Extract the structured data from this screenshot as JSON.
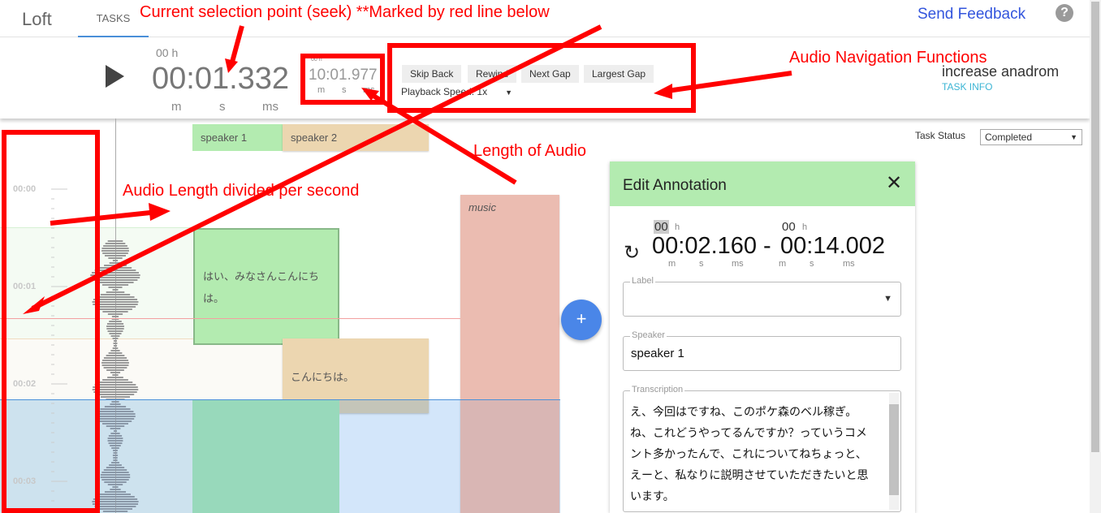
{
  "header": {
    "logo": "Loft",
    "tab": "TASKS",
    "feedback": "Send Feedback",
    "help": "?"
  },
  "toolbar": {
    "hours": "00 h",
    "time": "00:01.332",
    "units": [
      "m",
      "s",
      "ms"
    ],
    "duration": {
      "hours": "00 h",
      "time": "10:01.977",
      "units": [
        "m",
        "s",
        "ms"
      ]
    },
    "buttons": [
      "Skip Back",
      "Rewind",
      "Next Gap",
      "Largest Gap"
    ],
    "playback_speed_label": "Playback Speed: 1x",
    "task_name": "increase anadrom",
    "task_info": "TASK INFO"
  },
  "task_status": {
    "label": "Task Status",
    "value": "Completed"
  },
  "speakers": [
    "speaker 1",
    "speaker 2"
  ],
  "timeline": {
    "ticks": [
      "00:00",
      "00:01",
      "00:02",
      "00:03"
    ]
  },
  "segments": {
    "s1": "はい、みなさんこんにちは。",
    "s2": "こんにちは。",
    "music": "music"
  },
  "add_button": "+",
  "panel": {
    "title": "Edit Annotation",
    "start_h": "00",
    "end_h": "00",
    "h": "h",
    "start": "00:02.160",
    "sep": "-",
    "end": "00:14.002",
    "units": [
      "m",
      "s",
      "ms"
    ],
    "label_field": "Label",
    "label_value": "",
    "speaker_field": "Speaker",
    "speaker_value": "speaker 1",
    "transcription_field": "Transcription",
    "transcription": "え、今回はですね、このポケ森のベル稼ぎ。ね、これどうやってるんですか？っていうコメント多かったんで、これについてねちょっと、えーと、私なりに説明させていただきたいと思います。"
  },
  "annotations": {
    "seek": "Current selection point (seek) **Marked by red line below",
    "nav": "Audio Navigation Functions",
    "length": "Length of Audio",
    "per_second": "Audio Length divided per second"
  },
  "colors": {
    "speaker1": "#b3ebb0",
    "speaker2": "#ecd6b0",
    "music": "#ebbcb1",
    "selection": "#d3e6fa",
    "accent": "#4a86e8"
  }
}
